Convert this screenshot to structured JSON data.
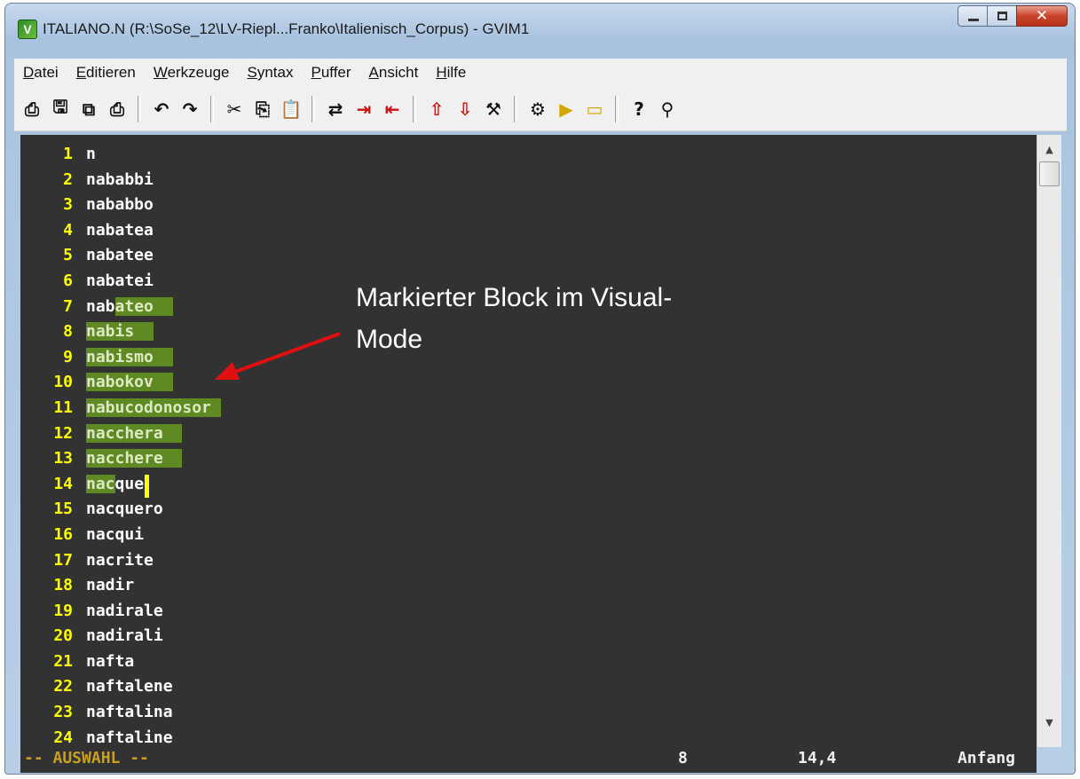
{
  "window": {
    "title": "ITALIANO.N (R:\\SoSe_12\\LV-Riepl...Franko\\Italienisch_Corpus) - GVIM1",
    "app_icon_glyph": "V"
  },
  "menubar": [
    {
      "u": "D",
      "rest": "atei"
    },
    {
      "u": "E",
      "rest": "ditieren"
    },
    {
      "u": "W",
      "rest": "erkzeuge"
    },
    {
      "u": "S",
      "rest": "yntax"
    },
    {
      "u": "P",
      "rest": "uffer"
    },
    {
      "u": "A",
      "rest": "nsicht"
    },
    {
      "u": "H",
      "rest": "ilfe"
    }
  ],
  "toolbar": {
    "groups": [
      [
        {
          "name": "open-file-icon",
          "glyph": "⎙"
        },
        {
          "name": "save-icon",
          "glyph": "🖫"
        },
        {
          "name": "save-all-icon",
          "glyph": "⧉"
        },
        {
          "name": "print-icon",
          "glyph": "⎙"
        }
      ],
      [
        {
          "name": "undo-icon",
          "glyph": "↶"
        },
        {
          "name": "redo-icon",
          "glyph": "↷"
        }
      ],
      [
        {
          "name": "cut-icon",
          "glyph": "✂"
        },
        {
          "name": "copy-icon",
          "glyph": "⎘"
        },
        {
          "name": "paste-icon",
          "glyph": "📋"
        }
      ],
      [
        {
          "name": "find-replace-icon",
          "glyph": "⇄"
        },
        {
          "name": "find-next-icon",
          "glyph": "⇥",
          "color": "red"
        },
        {
          "name": "find-prev-icon",
          "glyph": "⇤",
          "color": "red"
        }
      ],
      [
        {
          "name": "load-session-icon",
          "glyph": "⇧",
          "color": "red"
        },
        {
          "name": "save-session-icon",
          "glyph": "⇩",
          "color": "red"
        },
        {
          "name": "run-script-icon",
          "glyph": "⚒"
        }
      ],
      [
        {
          "name": "make-icon",
          "glyph": "⚙"
        },
        {
          "name": "shell-icon",
          "glyph": "▶",
          "color": "yellow"
        },
        {
          "name": "ctags-icon",
          "glyph": "▭",
          "color": "yellow"
        }
      ],
      [
        {
          "name": "help-icon",
          "glyph": "?"
        },
        {
          "name": "find-help-icon",
          "glyph": "⚲"
        }
      ]
    ]
  },
  "editor": {
    "lines": [
      {
        "n": "1",
        "pre": "n",
        "sel": "",
        "post": ""
      },
      {
        "n": "2",
        "pre": "nababbi",
        "sel": "",
        "post": ""
      },
      {
        "n": "3",
        "pre": "nababbo",
        "sel": "",
        "post": ""
      },
      {
        "n": "4",
        "pre": "nabatea",
        "sel": "",
        "post": ""
      },
      {
        "n": "5",
        "pre": "nabatee",
        "sel": "",
        "post": ""
      },
      {
        "n": "6",
        "pre": "nabatei",
        "sel": "",
        "post": ""
      },
      {
        "n": "7",
        "pre": "nab",
        "sel": "ateo  ",
        "post": ""
      },
      {
        "n": "8",
        "pre": "",
        "sel": "nabis  ",
        "post": ""
      },
      {
        "n": "9",
        "pre": "",
        "sel": "nabismo  ",
        "post": ""
      },
      {
        "n": "10",
        "pre": "",
        "sel": "nabokov  ",
        "post": ""
      },
      {
        "n": "11",
        "pre": "",
        "sel": "nabucodonosor ",
        "post": ""
      },
      {
        "n": "12",
        "pre": "",
        "sel": "nacchera  ",
        "post": ""
      },
      {
        "n": "13",
        "pre": "",
        "sel": "nacchere  ",
        "post": ""
      },
      {
        "n": "14",
        "pre": "",
        "sel": "nac",
        "post": "que"
      },
      {
        "n": "15",
        "pre": "nacquero",
        "sel": "",
        "post": ""
      },
      {
        "n": "16",
        "pre": "nacqui",
        "sel": "",
        "post": ""
      },
      {
        "n": "17",
        "pre": "nacrite",
        "sel": "",
        "post": ""
      },
      {
        "n": "18",
        "pre": "nadir",
        "sel": "",
        "post": ""
      },
      {
        "n": "19",
        "pre": "nadirale",
        "sel": "",
        "post": ""
      },
      {
        "n": "20",
        "pre": "nadirali",
        "sel": "",
        "post": ""
      },
      {
        "n": "21",
        "pre": "nafta",
        "sel": "",
        "post": ""
      },
      {
        "n": "22",
        "pre": "naftalene",
        "sel": "",
        "post": ""
      },
      {
        "n": "23",
        "pre": "naftalina",
        "sel": "",
        "post": ""
      },
      {
        "n": "24",
        "pre": "naftaline",
        "sel": "",
        "post": ""
      }
    ]
  },
  "statusline": {
    "mode": "-- AUSWAHL --",
    "count": "8",
    "position": "14,4",
    "scroll": "Anfang"
  },
  "annotation": {
    "line1": "Markierter Block im Visual-",
    "line2": "Mode"
  },
  "colors": {
    "editor_bg": "#323232",
    "line_number": "#ffff00",
    "selection_bg": "#5f8a23",
    "arrow": "#e01010"
  }
}
